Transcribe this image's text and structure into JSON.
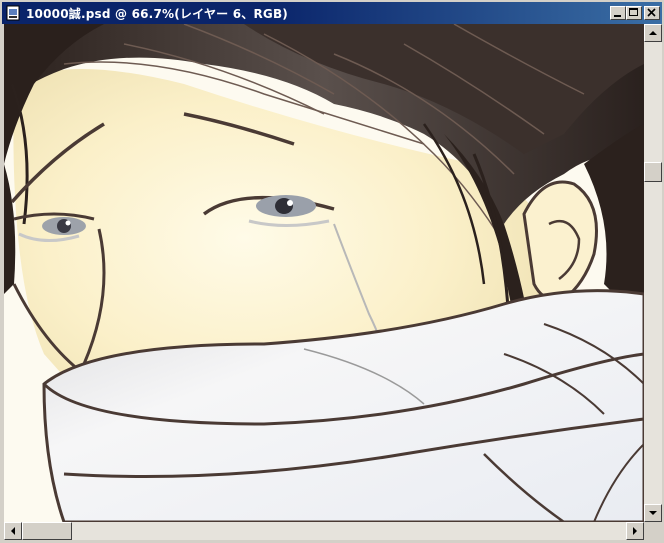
{
  "window": {
    "title": "10000誠.psd @ 66.7%(レイヤー 6、RGB)",
    "icon": "photoshop-document-icon",
    "controls": [
      "minimize-icon",
      "maximize-icon",
      "close-icon"
    ]
  },
  "canvas": {
    "artwork": "manga-style illustration of a crying person with a white scarf over the mouth",
    "colors": {
      "hair": "#2b1f1a",
      "line": "#4a3a34",
      "skin": "#fbf3d2",
      "scarf": "#f2f2f4",
      "tear": "#b8b8b8"
    }
  },
  "scrollbars": {
    "vertical_position": 0.28,
    "horizontal_position": 0.0
  }
}
